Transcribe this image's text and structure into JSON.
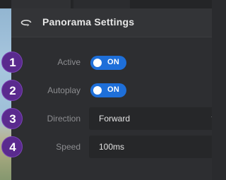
{
  "panel": {
    "title": "Panorama Settings",
    "icon": "panorama-rotate-icon"
  },
  "settings": [
    {
      "badge": "1",
      "label": "Active",
      "control": "toggle",
      "value": "ON",
      "on": true
    },
    {
      "badge": "2",
      "label": "Autoplay",
      "control": "toggle",
      "value": "ON",
      "on": true
    },
    {
      "badge": "3",
      "label": "Direction",
      "control": "select",
      "value": "Forward"
    },
    {
      "badge": "4",
      "label": "Speed",
      "control": "input",
      "value": "100ms"
    }
  ],
  "colors": {
    "accent": "#1e6fd9",
    "badge": "#5a2a8e",
    "panel_bg": "#2d2e31",
    "header_bg": "#333437",
    "field_bg": "#262729"
  }
}
